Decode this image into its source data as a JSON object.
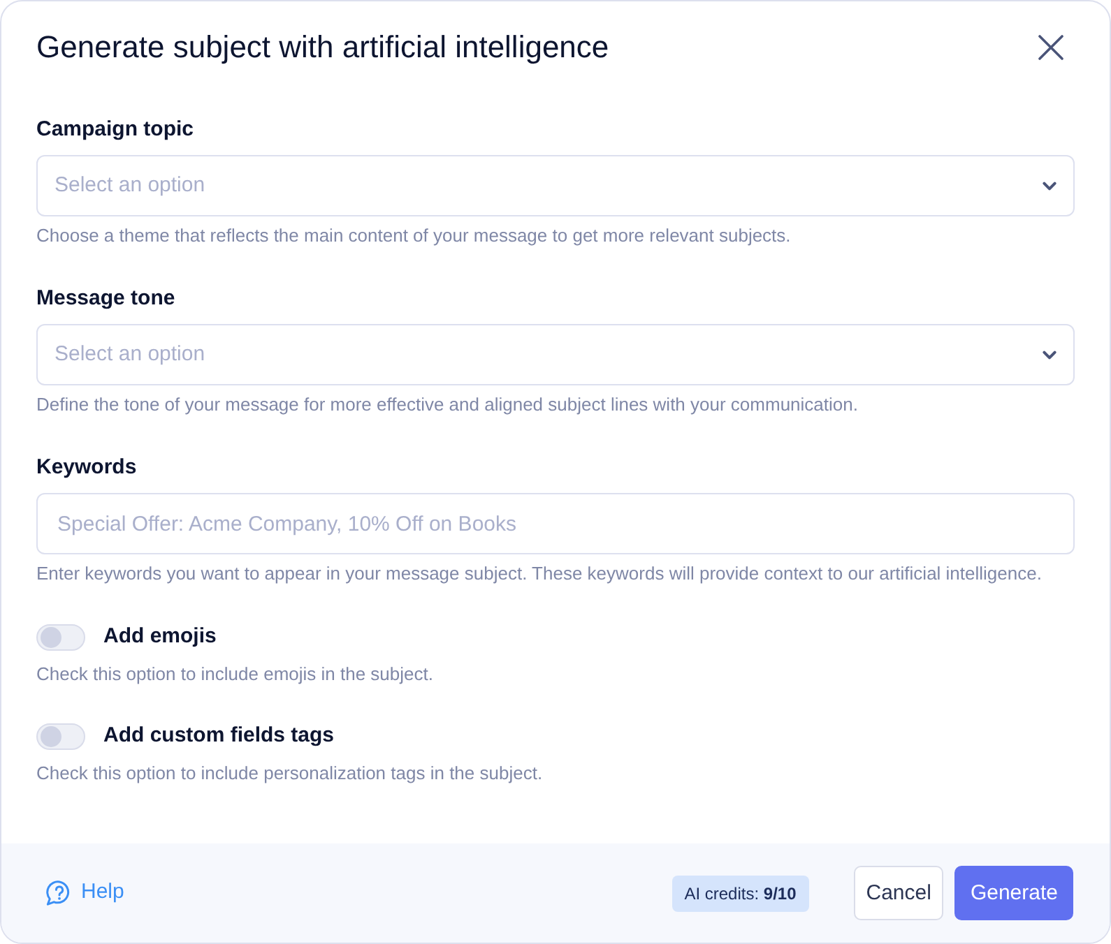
{
  "dialog": {
    "title": "Generate subject with artificial intelligence"
  },
  "fields": [
    {
      "kind": "select",
      "label": "Campaign topic",
      "placeholder": "Select an option",
      "help": "Choose a theme that reflects the main content of your message to get more relevant subjects."
    },
    {
      "kind": "select",
      "label": "Message tone",
      "placeholder": "Select an option",
      "help": "Define the tone of your message for more effective and aligned subject lines with your communication."
    },
    {
      "kind": "text",
      "label": "Keywords",
      "placeholder": "Special Offer: Acme Company, 10% Off on Books",
      "help": "Enter keywords you want to appear in your message subject. These keywords will provide context to our artificial intelligence."
    }
  ],
  "toggles": [
    {
      "label": "Add emojis",
      "on": false,
      "help": "Check this option to include emojis in the subject."
    },
    {
      "label": "Add custom fields tags",
      "on": false,
      "help": "Check this option to include personalization tags in the subject."
    }
  ],
  "footer": {
    "help_link": "Help",
    "credits": "AI credits: **9/10**",
    "buttons": [
      {
        "label": "Cancel",
        "kind": "secondary"
      },
      {
        "label": "Generate",
        "kind": "primary"
      }
    ]
  }
}
